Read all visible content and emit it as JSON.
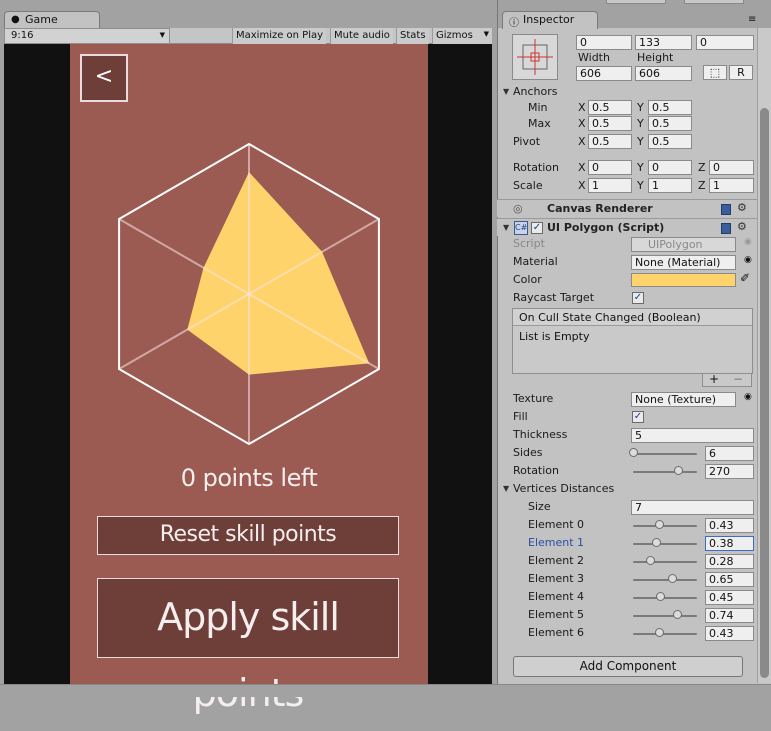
{
  "game_panel": {
    "tab_label": "Game",
    "aspect_value": "9:16",
    "toolbar_buttons": [
      "Maximize on Play",
      "Mute audio",
      "Stats",
      "Gizmos"
    ],
    "back_label": "<",
    "points_text": "0 points left",
    "reset_label": "Reset skill points",
    "apply_label": "Apply skill points",
    "panel_color": "#9b5b52",
    "button_color": "#6e3e39",
    "polygon_color": "#ffd36b",
    "radar": {
      "sides": 6,
      "vertex_distances": [
        0.43,
        0.38,
        0.28,
        0.65,
        0.45,
        0.74,
        0.43
      ]
    }
  },
  "inspector": {
    "tab_label": "Inspector",
    "rect": {
      "pos_values": [
        "0",
        "133",
        "0"
      ],
      "width_label": "Width",
      "height_label": "Height",
      "width": "606",
      "height": "606",
      "raw_btn": "R"
    },
    "anchors": {
      "label": "Anchors",
      "min_label": "Min",
      "max_label": "Max",
      "min_x": "0.5",
      "min_y": "0.5",
      "max_x": "0.5",
      "max_y": "0.5"
    },
    "pivot": {
      "label": "Pivot",
      "x": "0.5",
      "y": "0.5"
    },
    "rotation": {
      "label": "Rotation",
      "x": "0",
      "y": "0",
      "z": "0"
    },
    "scale": {
      "label": "Scale",
      "x": "1",
      "y": "1",
      "z": "1"
    },
    "axis": {
      "x": "X",
      "y": "Y",
      "z": "Z"
    },
    "canvas_renderer": "Canvas Renderer",
    "ui_polygon": {
      "title": "UI Polygon (Script)",
      "script_label": "Script",
      "script_value": "UIPolygon",
      "material_label": "Material",
      "material_value": "None (Material)",
      "color_label": "Color",
      "color_value": "#ffd36b",
      "raycast_label": "Raycast Target",
      "event_title": "On Cull State Changed (Boolean)",
      "event_empty": "List is Empty",
      "plus": "+",
      "minus": "−",
      "texture_label": "Texture",
      "texture_value": "None (Texture)",
      "fill_label": "Fill",
      "thickness_label": "Thickness",
      "thickness_value": "5",
      "sides_label": "Sides",
      "sides_value": "6",
      "sides_fraction": 0.0,
      "rotation_label": "Rotation",
      "rotation_value": "270",
      "rotation_fraction": 0.75,
      "vd_label": "Vertices Distances",
      "size_label": "Size",
      "size_value": "7",
      "elements": [
        {
          "label": "Element 0",
          "value": "0.43",
          "fraction": 0.43
        },
        {
          "label": "Element 1",
          "value": "0.38",
          "fraction": 0.38
        },
        {
          "label": "Element 2",
          "value": "0.28",
          "fraction": 0.28
        },
        {
          "label": "Element 3",
          "value": "0.65",
          "fraction": 0.65
        },
        {
          "label": "Element 4",
          "value": "0.45",
          "fraction": 0.45
        },
        {
          "label": "Element 5",
          "value": "0.74",
          "fraction": 0.74
        },
        {
          "label": "Element 6",
          "value": "0.43",
          "fraction": 0.43
        }
      ]
    },
    "add_component": "Add Component"
  }
}
